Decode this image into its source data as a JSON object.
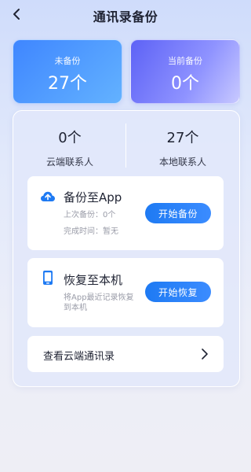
{
  "header": {
    "title": "通讯录备份",
    "back_icon": "chevron-left-icon"
  },
  "stats": {
    "not_backed_up": {
      "label": "未备份",
      "value": "27个"
    },
    "current_backup": {
      "label": "当前备份",
      "value": "0个"
    }
  },
  "counts": {
    "cloud": {
      "value": "0个",
      "label": "云端联系人"
    },
    "local": {
      "value": "27个",
      "label": "本地联系人"
    }
  },
  "backup": {
    "icon": "cloud-upload-icon",
    "title": "备份至App",
    "last_backup": "上次备份：0个",
    "completed_time": "完成时间：暂无",
    "button_label": "开始备份"
  },
  "restore": {
    "icon": "phone-icon",
    "title": "恢复至本机",
    "description_line1": "将App最近记录恢复",
    "description_line2": "到本机",
    "button_label": "开始恢复"
  },
  "cloud_contacts": {
    "label": "查看云端通讯录",
    "icon": "chevron-right-icon"
  },
  "colors": {
    "accent": "#1e7af3",
    "card_blue": "#3f86ff",
    "card_purple": "#5d62f6"
  }
}
